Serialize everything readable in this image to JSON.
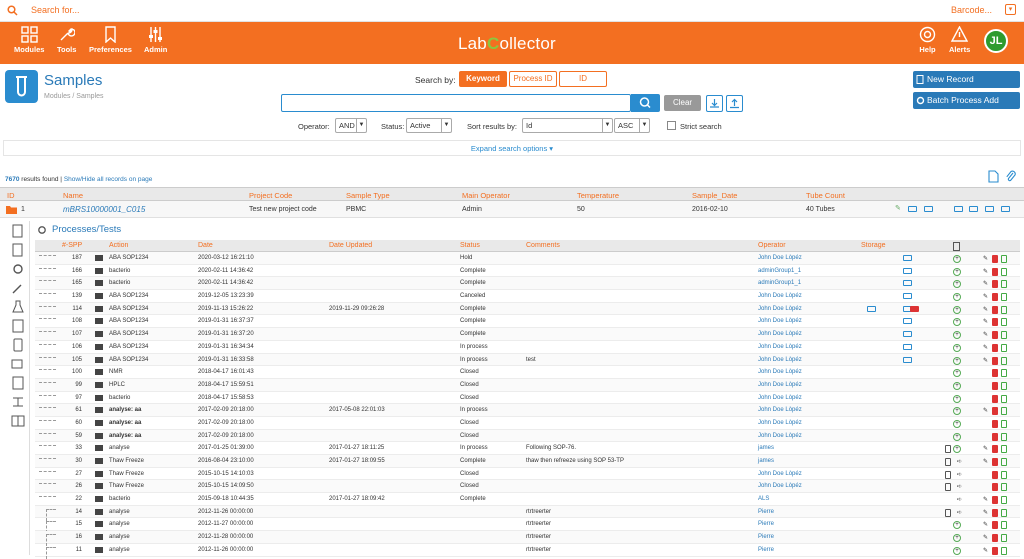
{
  "topbar": {
    "search_placeholder": "Search for...",
    "barcode": "Barcode..."
  },
  "nav": {
    "modules": "Modules",
    "tools": "Tools",
    "preferences": "Preferences",
    "admin": "Admin",
    "help": "Help",
    "alerts": "Alerts",
    "logo_a": "Lab",
    "logo_b": "C",
    "logo_c": "ollector",
    "avatar": "JL"
  },
  "page": {
    "title": "Samples",
    "breadcrumb": "Modules / Samples"
  },
  "search": {
    "label": "Search by:",
    "mode_keyword": "Keyword",
    "mode_process": "Process ID",
    "mode_id": "ID",
    "clear": "Clear",
    "value": ""
  },
  "actions": {
    "new_record": "New Record",
    "batch_process": "Batch Process Add"
  },
  "filters": {
    "operator_label": "Operator:",
    "operator_value": "AND",
    "status_label": "Status:",
    "status_value": "Active",
    "sort_label": "Sort results by:",
    "sort_value": "Id",
    "order_value": "ASC",
    "strict_label": "Strict search"
  },
  "expand": "Expand search options ▾",
  "results": {
    "count": "7670",
    "found_text": "results found",
    "toggle": "Show/Hide all records on page"
  },
  "columns": {
    "id": "ID",
    "name": "Name",
    "project": "Project Code",
    "type": "Sample Type",
    "operator": "Main Operator",
    "temp": "Temperature",
    "date": "Sample_Date",
    "tubes": "Tube Count"
  },
  "sample": {
    "id": "1",
    "name": "mBRS10000001_C015",
    "project": "Test new project code",
    "type": "PBMC",
    "operator": "Admin",
    "temp": "50",
    "date": "2016-02-10",
    "tubes": "40 Tubes"
  },
  "processes": {
    "title": "Processes/Tests",
    "headers": {
      "spp": "#-SPP",
      "action": "Action",
      "date": "Date",
      "updated": "Date Updated",
      "status": "Status",
      "comments": "Comments",
      "operator": "Operator",
      "storage": "Storage"
    },
    "rows": [
      {
        "spp": "187",
        "action": "ABA SOP1234",
        "date": "2020-03-12 16:21:10",
        "updated": "",
        "status": "Hold",
        "comment": "",
        "operator": "John Doe Lòpéz"
      },
      {
        "spp": "166",
        "action": "bacterio",
        "date": "2020-02-11 14:36:42",
        "updated": "",
        "status": "Complete",
        "comment": "",
        "operator": "adminGroup1_1"
      },
      {
        "spp": "165",
        "action": "bacterio",
        "date": "2020-02-11 14:36:42",
        "updated": "",
        "status": "Complete",
        "comment": "",
        "operator": "adminGroup1_1"
      },
      {
        "spp": "139",
        "action": "ABA SOP1234",
        "date": "2019-12-05 13:23:39",
        "updated": "",
        "status": "Canceled",
        "comment": "",
        "operator": "John Doe Lòpéz"
      },
      {
        "spp": "114",
        "action": "ABA SOP1234",
        "date": "2019-11-13 15:26:22",
        "updated": "2019-11-29 09:26:28",
        "status": "Complete",
        "comment": "",
        "operator": "John Doe Lòpéz"
      },
      {
        "spp": "108",
        "action": "ABA SOP1234",
        "date": "2019-01-31 16:37:37",
        "updated": "",
        "status": "Complete",
        "comment": "",
        "operator": "John Doe Lòpéz"
      },
      {
        "spp": "107",
        "action": "ABA SOP1234",
        "date": "2019-01-31 16:37:20",
        "updated": "",
        "status": "Complete",
        "comment": "",
        "operator": "John Doe Lòpéz"
      },
      {
        "spp": "106",
        "action": "ABA SOP1234",
        "date": "2019-01-31 16:34:34",
        "updated": "",
        "status": "In process",
        "comment": "",
        "operator": "John Doe Lòpéz"
      },
      {
        "spp": "105",
        "action": "ABA SOP1234",
        "date": "2019-01-31 16:33:58",
        "updated": "",
        "status": "In process",
        "comment": "test",
        "operator": "John Doe Lòpéz"
      },
      {
        "spp": "100",
        "action": "NMR",
        "date": "2018-04-17 16:01:43",
        "updated": "",
        "status": "Closed",
        "comment": "",
        "operator": "John Doe Lòpéz"
      },
      {
        "spp": "99",
        "action": "HPLC",
        "date": "2018-04-17 15:59:51",
        "updated": "",
        "status": "Closed",
        "comment": "",
        "operator": "John Doe Lòpéz"
      },
      {
        "spp": "97",
        "action": "bacterio",
        "date": "2018-04-17 15:58:53",
        "updated": "",
        "status": "Closed",
        "comment": "",
        "operator": "John Doe Lòpéz"
      },
      {
        "spp": "61",
        "action": "analyse: aa",
        "date": "2017-02-09 20:18:00",
        "updated": "2017-05-08 22:01:03",
        "status": "In process",
        "comment": "",
        "operator": "John Doe Lòpéz"
      },
      {
        "spp": "60",
        "action": "analyse: aa",
        "date": "2017-02-09 20:18:00",
        "updated": "",
        "status": "Closed",
        "comment": "",
        "operator": "John Doe Lòpéz"
      },
      {
        "spp": "59",
        "action": "analyse: aa",
        "date": "2017-02-09 20:18:00",
        "updated": "",
        "status": "Closed",
        "comment": "",
        "operator": "John Doe Lòpéz"
      },
      {
        "spp": "33",
        "action": "analyse",
        "date": "2017-01-25 01:39:00",
        "updated": "2017-01-27 18:11:25",
        "status": "In process",
        "comment": "Following SOP-76.",
        "operator": "james"
      },
      {
        "spp": "30",
        "action": "Thaw Freeze",
        "date": "2016-08-04 23:10:00",
        "updated": "2017-01-27 18:09:55",
        "status": "Complete",
        "comment": "thaw then refreeze using SOP 53-TP",
        "operator": "james"
      },
      {
        "spp": "27",
        "action": "Thaw Freeze",
        "date": "2015-10-15 14:10:03",
        "updated": "",
        "status": "Closed",
        "comment": "",
        "operator": "John Doe Lòpéz"
      },
      {
        "spp": "26",
        "action": "Thaw Freeze",
        "date": "2015-10-15 14:09:50",
        "updated": "",
        "status": "Closed",
        "comment": "",
        "operator": "John Doe Lòpéz"
      },
      {
        "spp": "22",
        "action": "bacterio",
        "date": "2015-09-18 10:44:35",
        "updated": "2017-01-27 18:09:42",
        "status": "Complete",
        "comment": "",
        "operator": "ALS"
      },
      {
        "spp": "14",
        "action": "analyse",
        "date": "2012-11-26 00:00:00",
        "updated": "",
        "status": "",
        "comment": "rtrtreerter",
        "operator": "Pierre"
      },
      {
        "spp": "15",
        "action": "analyse",
        "date": "2012-11-27 00:00:00",
        "updated": "",
        "status": "",
        "comment": "rtrtreerter",
        "operator": "Pierre"
      },
      {
        "spp": "16",
        "action": "analyse",
        "date": "2012-11-28 00:00:00",
        "updated": "",
        "status": "",
        "comment": "rtrtreerter",
        "operator": "Pierre"
      },
      {
        "spp": "11",
        "action": "analyse",
        "date": "2012-11-26 00:00:00",
        "updated": "",
        "status": "",
        "comment": "rtrtreerter",
        "operator": "Pierre"
      }
    ]
  },
  "colors": {
    "brand": "#f36f21",
    "link": "#2a7ab8",
    "accent_green": "#8cc63f"
  }
}
